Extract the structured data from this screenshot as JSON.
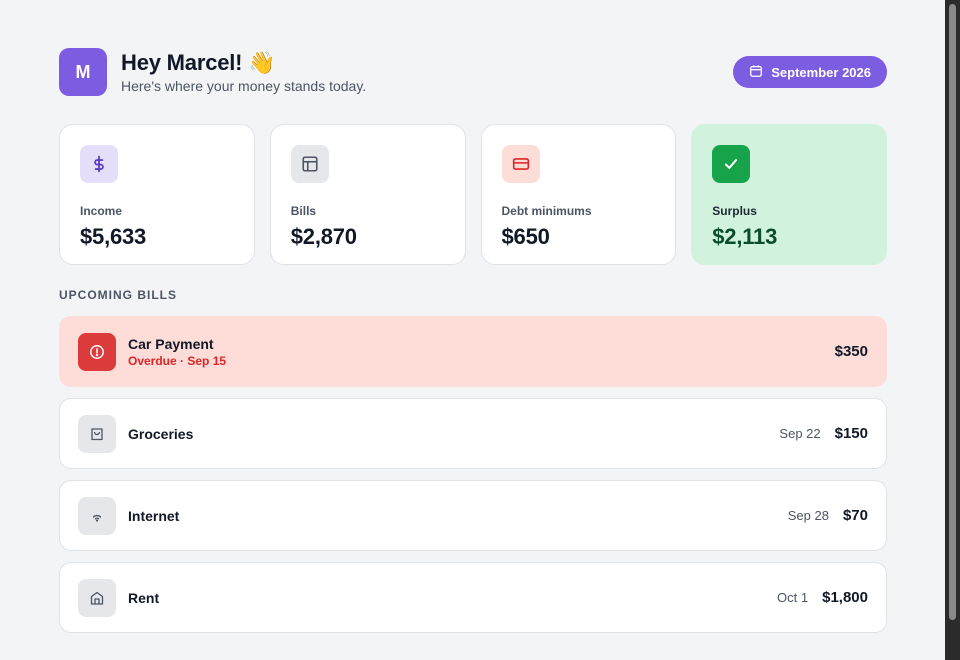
{
  "header": {
    "avatar_letter": "M",
    "greeting": "Hey Marcel! 👋",
    "subtitle": "Here's where your money stands today.",
    "month_label": "September 2026"
  },
  "stats": [
    {
      "label": "Income",
      "value": "$5,633",
      "icon": "dollar-icon"
    },
    {
      "label": "Bills",
      "value": "$2,870",
      "icon": "layout-icon"
    },
    {
      "label": "Debt minimums",
      "value": "$650",
      "icon": "credit-card-icon"
    },
    {
      "label": "Surplus",
      "value": "$2,113",
      "icon": "check-icon"
    }
  ],
  "section_title": "UPCOMING BILLS",
  "bills": [
    {
      "name": "Car Payment",
      "status": "Overdue · Sep 15",
      "date": "",
      "amount": "$350",
      "icon": "alert-icon"
    },
    {
      "name": "Groceries",
      "status": "",
      "date": "Sep 22",
      "amount": "$150",
      "icon": "shopping-bag-icon"
    },
    {
      "name": "Internet",
      "status": "",
      "date": "Sep 28",
      "amount": "$70",
      "icon": "wifi-icon"
    },
    {
      "name": "Rent",
      "status": "",
      "date": "Oct 1",
      "amount": "$1,800",
      "icon": "house-icon"
    }
  ],
  "colors": {
    "accent": "#7c5ce0",
    "overdue_bg": "#fedcd8",
    "overdue_red": "#dc2626",
    "surplus_bg": "#d1f2dc",
    "surplus_green": "#16a34a"
  }
}
